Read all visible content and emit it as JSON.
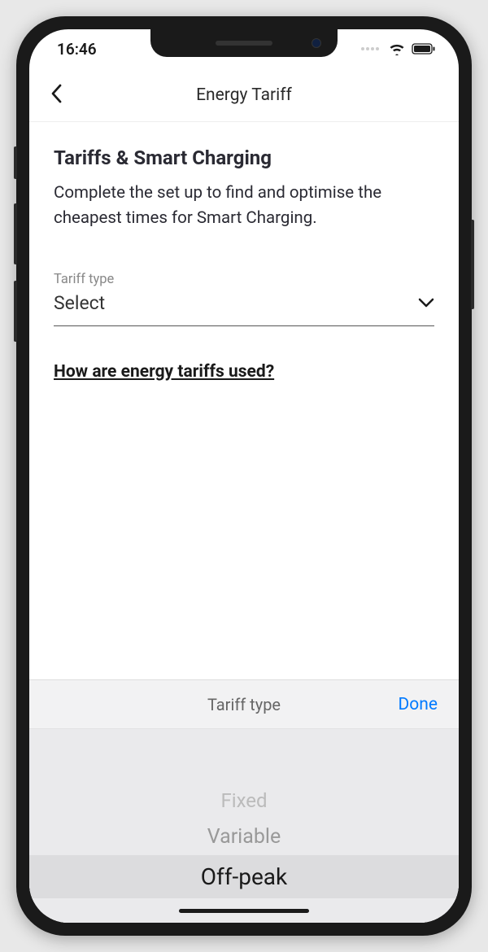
{
  "statusBar": {
    "time": "16:46"
  },
  "header": {
    "title": "Energy Tariff"
  },
  "content": {
    "sectionTitle": "Tariffs & Smart Charging",
    "sectionDesc": "Complete the set up to find and optimise the cheapest times for Smart Charging.",
    "fieldLabel": "Tariff type",
    "fieldValue": "Select",
    "helpLink": "How are energy tariffs used?"
  },
  "picker": {
    "title": "Tariff type",
    "doneLabel": "Done",
    "options": [
      "Fixed",
      "Variable",
      "Off-peak"
    ],
    "selectedIndex": 2
  }
}
